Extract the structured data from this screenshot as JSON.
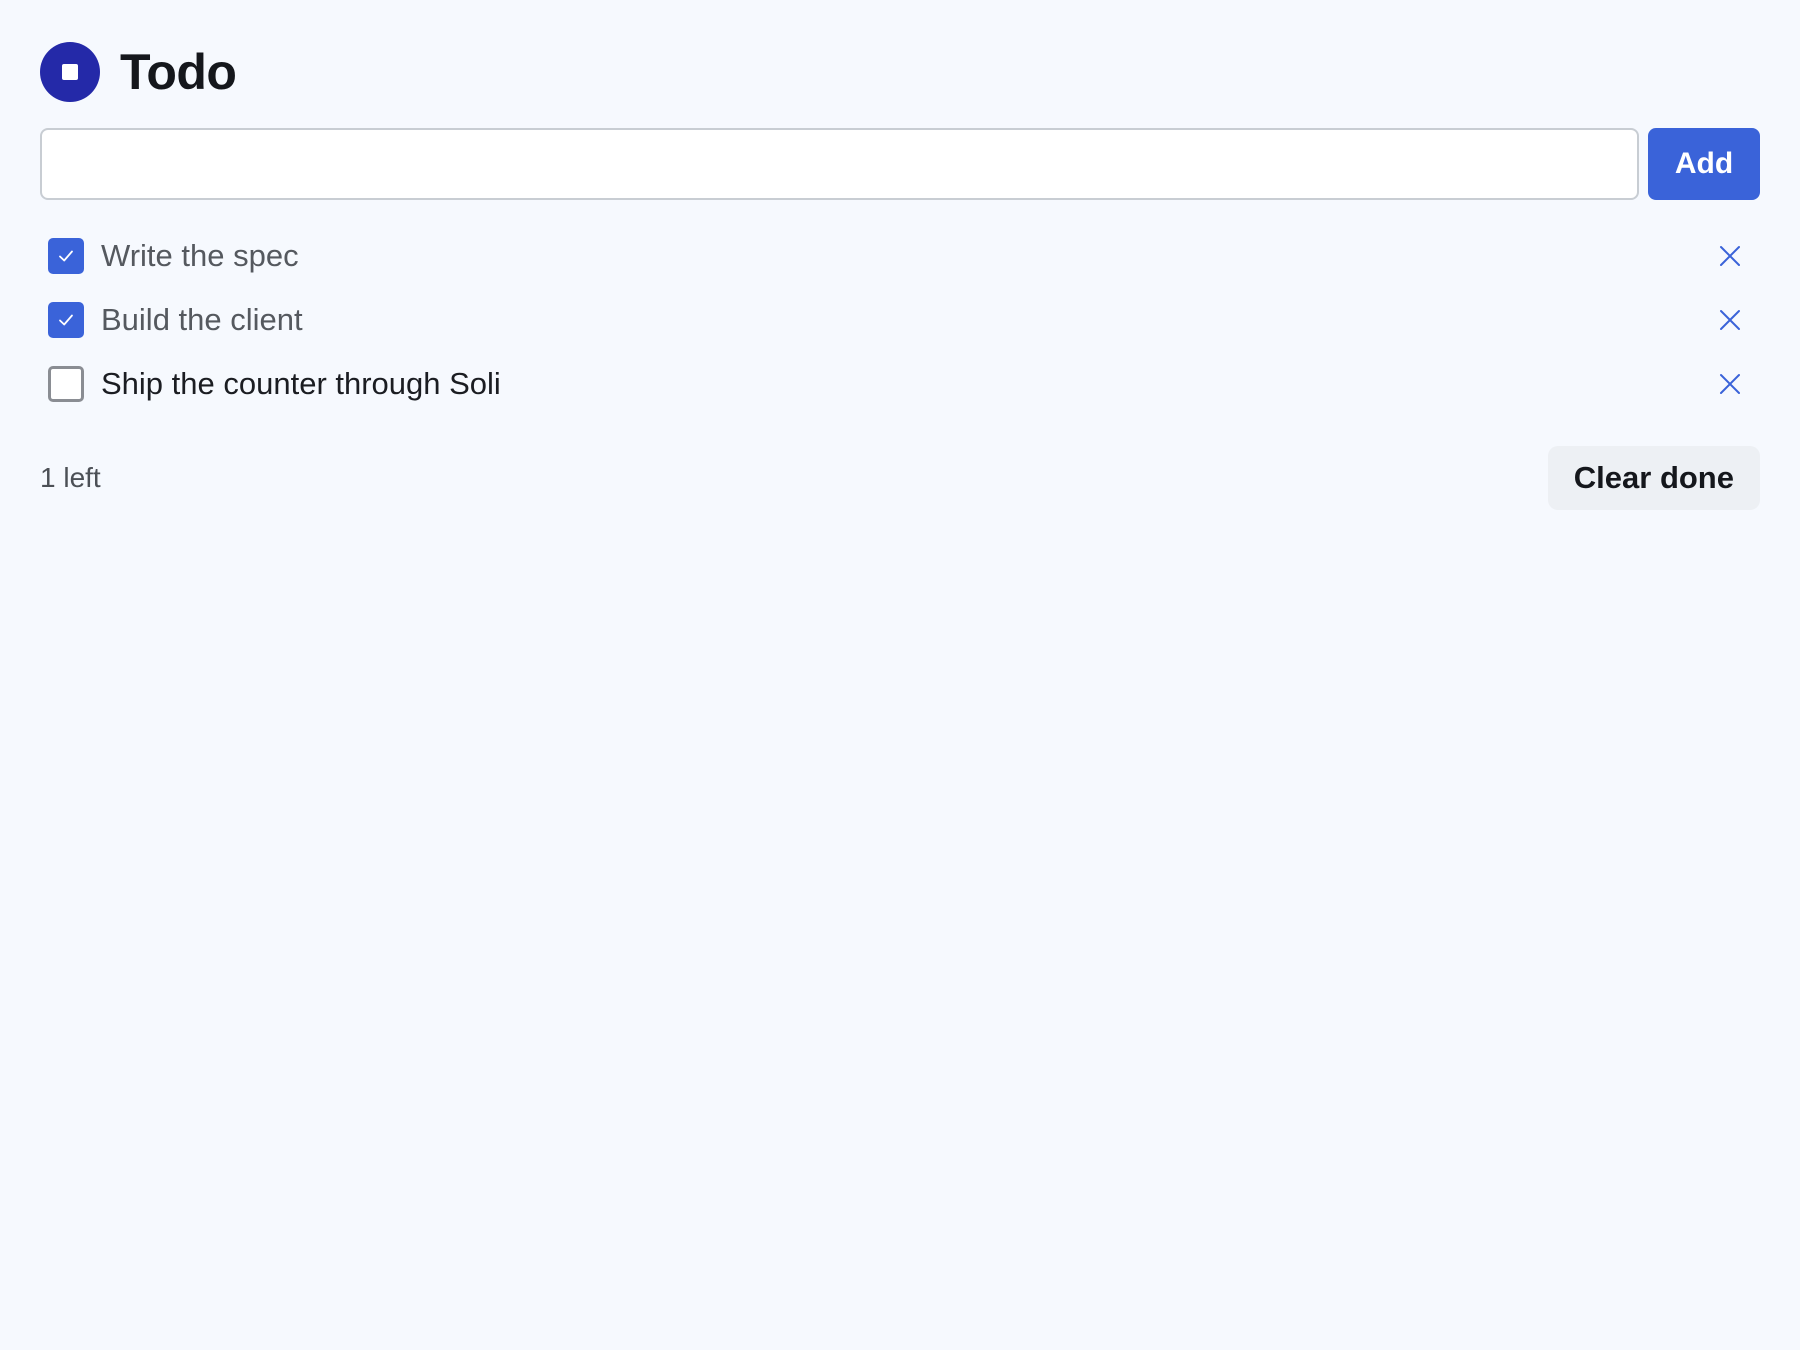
{
  "header": {
    "title": "Todo",
    "logo_icon": "stop-circle-icon",
    "logo_color": "#2429a8"
  },
  "new_todo": {
    "value": "",
    "placeholder": "",
    "add_label": "Add"
  },
  "todos": [
    {
      "text": "Write the spec",
      "done": true
    },
    {
      "text": "Build the client",
      "done": true
    },
    {
      "text": "Ship the counter through Soli",
      "done": false
    }
  ],
  "footer": {
    "count_text": "1 left",
    "clear_label": "Clear done"
  },
  "colors": {
    "accent": "#3a63d9",
    "background": "#f6f9fe"
  },
  "icons": {
    "check": "checkmark-icon",
    "remove": "close-icon"
  }
}
